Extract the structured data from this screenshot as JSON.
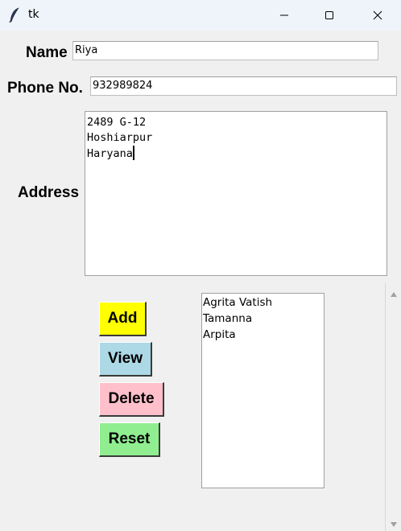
{
  "window": {
    "title": "tk",
    "icons": {
      "app": "feather-icon",
      "minimize": "minimize-icon",
      "maximize": "maximize-icon",
      "close": "close-icon"
    }
  },
  "form": {
    "name_label": "Name",
    "name_value": "Riya",
    "phone_label": "Phone No.",
    "phone_value": "932989824",
    "address_label": "Address",
    "address_lines": [
      "2489 G-12",
      "Hoshiarpur",
      "Haryana"
    ]
  },
  "buttons": {
    "add": {
      "label": "Add",
      "color": "#ffff00"
    },
    "view": {
      "label": "View",
      "color": "#add8e6"
    },
    "delete": {
      "label": "Delete",
      "color": "#ffc0cb"
    },
    "reset": {
      "label": "Reset",
      "color": "#90ee90"
    }
  },
  "contacts": {
    "items": [
      "Agrita Vatish",
      "Tamanna",
      "Arpita"
    ]
  },
  "scrollbar": {
    "icons": {
      "up": "scroll-up-arrow-icon",
      "down": "scroll-down-arrow-icon"
    }
  }
}
